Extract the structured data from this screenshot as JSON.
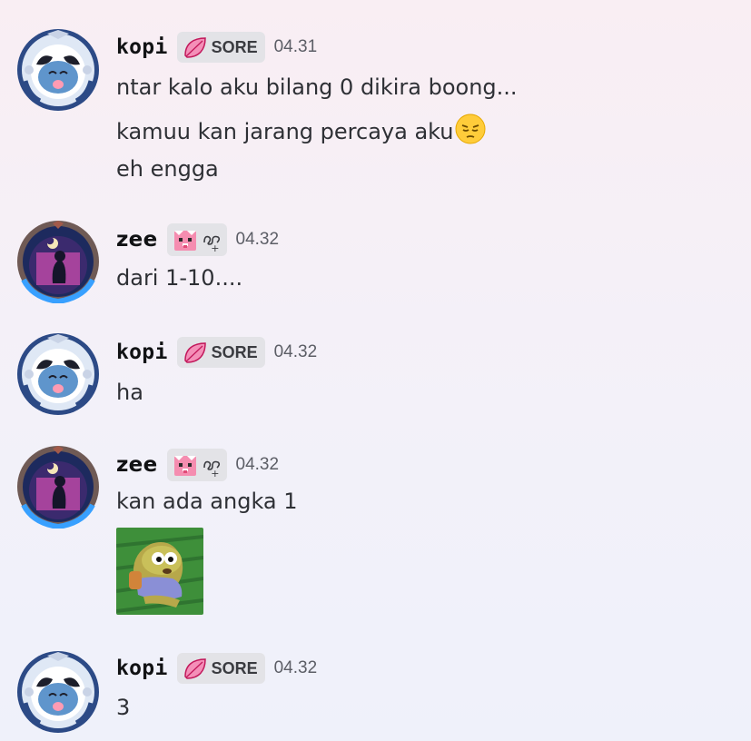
{
  "messages": [
    {
      "author": "kopi",
      "tag": "SORE",
      "time": "04.31",
      "lines": [
        "ntar kalo aku bilang 0 dikira boong...",
        "kamuu kan jarang percaya aku",
        "eh engga"
      ],
      "emoji": "pensive-face"
    },
    {
      "author": "zee",
      "tag": "",
      "time": "04.32",
      "lines": [
        "dari 1-10...."
      ]
    },
    {
      "author": "kopi",
      "tag": "SORE",
      "time": "04.32",
      "lines": [
        "ha"
      ]
    },
    {
      "author": "zee",
      "tag": "",
      "time": "04.32",
      "lines": [
        "kan ada angka 1"
      ],
      "attachment": "fish-sticker"
    },
    {
      "author": "kopi",
      "tag": "SORE",
      "time": "04.32",
      "lines": [
        "3"
      ]
    }
  ],
  "icons": {
    "kopi_tag_icon": "pink-leaf-icon",
    "zee_tag_icon": "pink-cat-icon"
  },
  "colors": {
    "background_top": "#f9eef3",
    "background_bottom": "#eff1fa",
    "tag_bg": "#e3e3e7",
    "leaf_pink": "#f48fb8"
  }
}
